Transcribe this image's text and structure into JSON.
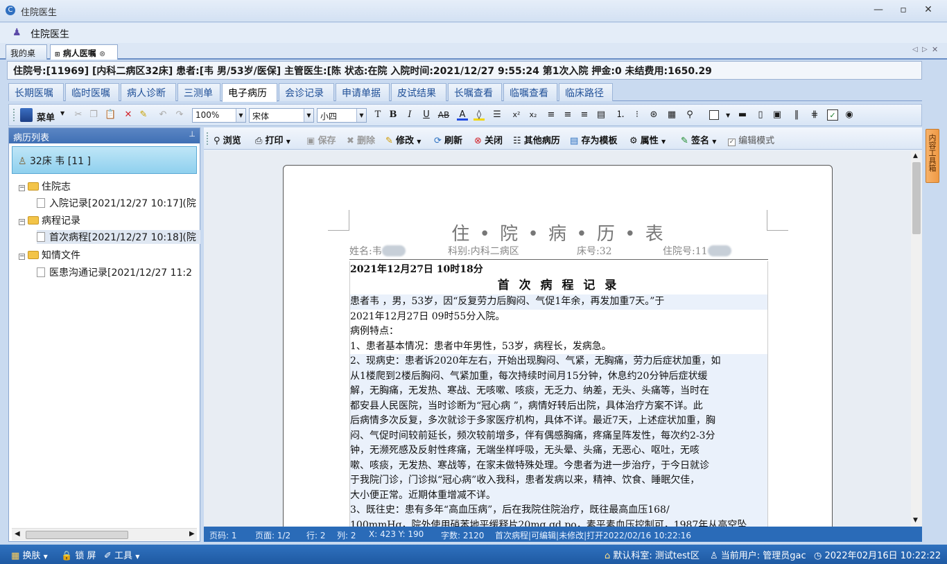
{
  "window": {
    "title": "住院医生"
  },
  "app_header": {
    "title": "住院医生"
  },
  "doc_tabs": [
    {
      "label": "我的桌面"
    },
    {
      "label": "病人医嘱"
    }
  ],
  "info_bar": {
    "text": "住院号:[11969] [内科二病区32床] 患者:[韦      男/53岁/医保] 主管医生:[陈      状态:在院 入院时间:2021/12/27 9:55:24 第1次入院 押金:0 未结费用:1650.29"
  },
  "module_tabs": [
    "长期医嘱",
    "临时医嘱",
    "病人诊断",
    "三测单",
    "电子病历",
    "会诊记录",
    "申请单据",
    "皮试结果",
    "长嘱查看",
    "临嘱查看",
    "临床路径"
  ],
  "editor_toolbar": {
    "menu_label": "菜单",
    "zoom": "100%",
    "font": "宋体",
    "font_size": "小四"
  },
  "left_panel": {
    "title": "病历列表",
    "patient": "32床  韦        [11      ]",
    "tree": [
      {
        "label": "住院志",
        "children": [
          "入院记录[2021/12/27 10:17](院"
        ]
      },
      {
        "label": "病程记录",
        "children": [
          "首次病程[2021/12/27 10:18](院"
        ]
      },
      {
        "label": "知情文件",
        "children": [
          "医患沟通记录[2021/12/27 11:2"
        ]
      }
    ]
  },
  "record_toolbar": {
    "browse": "浏览",
    "print": "打印",
    "save": "保存",
    "delete": "删除",
    "modify": "修改",
    "refresh": "刷新",
    "close": "关闭",
    "other": "其他病历",
    "save_template": "存为模板",
    "properties": "属性",
    "sign": "签名",
    "edit_mode": "编辑模式"
  },
  "side_tab": "内容工具箱",
  "document": {
    "title": "住 • 院 • 病 • 历 • 表",
    "header_name": "姓名:韦",
    "header_dept": "科别:内科二病区",
    "header_bed": "床号:32",
    "header_no": "住院号:11",
    "datetime": "2021年12月27日  10时18分",
    "record_title": "首 次 病 程 记 录",
    "lines": [
      "患者韦      ，男，53岁，因“反复劳力后胸闷、气促1年余，再发加重7天。”于",
      "2021年12月27日  09时55分入院。",
      "病例特点：",
      "1、患者基本情况：患者中年男性，53岁，病程长，发病急。",
      "2、现病史：患者诉2020年左右，开始出现胸闷、气紧，无胸痛，劳力后症状加重，如",
      "从1楼爬到2楼后胸闷、气紧加重，每次持续时间月15分钟，休息约20分钟后症状缓",
      "解，无胸痛，无发热、寒战、无咳嗽、咳痰，无乏力、纳差，无头、头痛等，当时在",
      "都安县人民医院，当时诊断为“冠心病 ”，病情好转后出院，具体治疗方案不详。此",
      "后病情多次反复，多次就诊于多家医疗机构，具体不详。最近7天，上述症状加重，胸",
      "闷、气促时间较前延长，频次较前增多，伴有偶感胸痛，疼痛呈阵发性，每次约2-3分",
      "钟，无濒死感及反射性疼痛，无端坐样呼吸，无头晕、头痛，无恶心、呕吐，无咳",
      "嗽、咳痰，无发热、寒战等，在家未做特殊处理。今患者为进一步治疗，于今日就诊",
      "于我院门诊，门诊拟“冠心病”收入我科，患者发病以来，精神、饮食、睡眠欠佳，",
      "大小便正常。近期体重增减不详。",
      "3、既往史：患有多年“高血压病”，后在我院住院治疗，既往最高血压168/",
      "100mmHg，院外使用硝苯地平缓释片20mg qd po，素平素血压控制可，1987年从高空坠"
    ]
  },
  "status_bar": {
    "page": "页码: 1",
    "page_of": "页面: 1/2",
    "row": "行: 2",
    "col": "列: 2",
    "xy": "X: 423 Y: 190",
    "chars": "字数: 2120",
    "state": "首次病程|可编辑|未修改|打开2022/02/16 10:22:16"
  },
  "bottom_bar": {
    "skin": "换肤",
    "lock": "锁 屏",
    "tools": "工具",
    "dept": "默认科室: 测试test区",
    "user": "当前用户: 管理员gac",
    "time": "2022年02月16日 10:22:22"
  }
}
